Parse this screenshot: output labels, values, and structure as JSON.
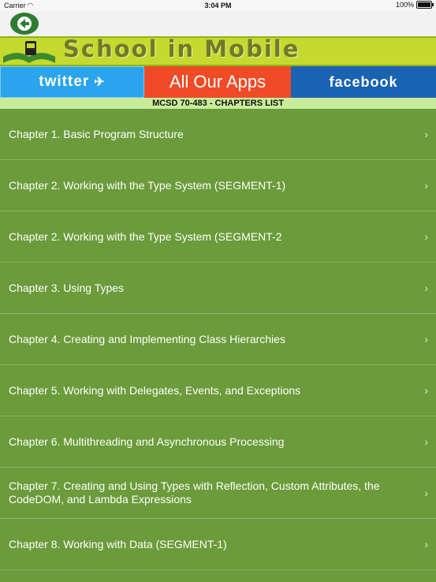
{
  "status": {
    "carrier": "Carrier",
    "time": "3:04 PM",
    "battery": "100%"
  },
  "banner": {
    "title": "School in Mobile"
  },
  "social": {
    "twitter": "twitter",
    "apps": "All Our Apps",
    "facebook": "facebook"
  },
  "header": {
    "title": "MCSD 70-483 - CHAPTERS LIST"
  },
  "chapters": [
    "Chapter 1. Basic Program Structure",
    "Chapter 2. Working with the Type System (SEGMENT-1)",
    "Chapter 2. Working with the Type System (SEGMENT-2",
    "Chapter 3. Using Types",
    "Chapter 4. Creating and Implementing Class Hierarchies",
    "Chapter 5. Working with Delegates, Events, and Exceptions",
    "Chapter 6. Multithreading and Asynchronous Processing",
    "Chapter 7. Creating and Using Types with Reflection, Custom Attributes, the CodeDOM, and Lambda Expressions",
    "Chapter 8. Working with Data (SEGMENT-1)"
  ],
  "colors": {
    "list_bg": "#6b9b3a",
    "banner_bg": "#c6d92f",
    "twitter": "#2aa4ec",
    "apps": "#ef4b27",
    "facebook": "#1a63b3"
  }
}
